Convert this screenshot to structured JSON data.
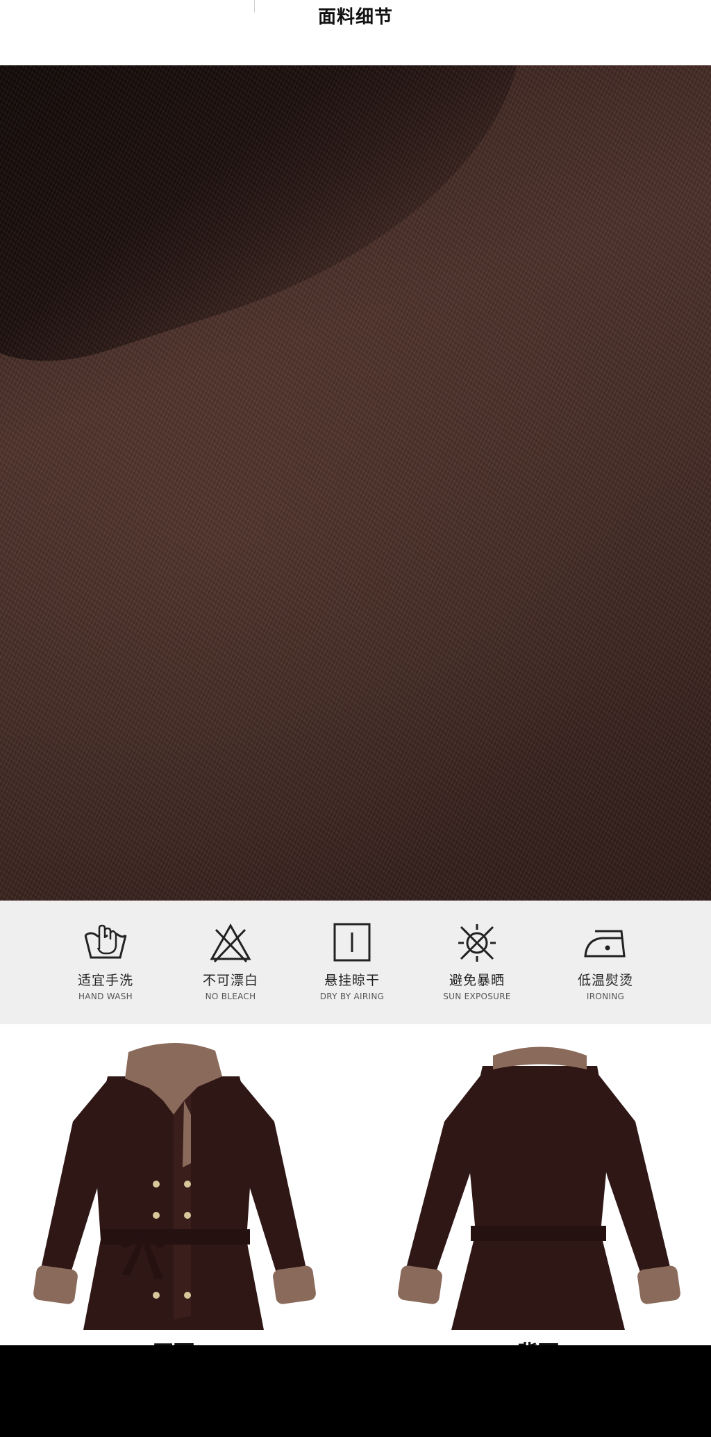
{
  "header": {
    "title": "面料细节"
  },
  "care": {
    "items": [
      {
        "icon": "hand-wash-icon",
        "cn": "适宜手洗",
        "en": "HAND WASH"
      },
      {
        "icon": "no-bleach-icon",
        "cn": "不可漂白",
        "en": "NO BLEACH"
      },
      {
        "icon": "hang-dry-icon",
        "cn": "悬挂晾干",
        "en": "DRY BY AIRING"
      },
      {
        "icon": "sun-icon",
        "cn": "避免暴晒",
        "en": "SUN EXPOSURE"
      },
      {
        "icon": "iron-icon",
        "cn": "低温熨烫",
        "en": "IRONING"
      }
    ]
  },
  "coats": {
    "front_label": "正面",
    "back_label": "背面"
  },
  "colors": {
    "coat": "#2f1716",
    "fur": "#8a6a5a",
    "button": "#d7c79a"
  }
}
